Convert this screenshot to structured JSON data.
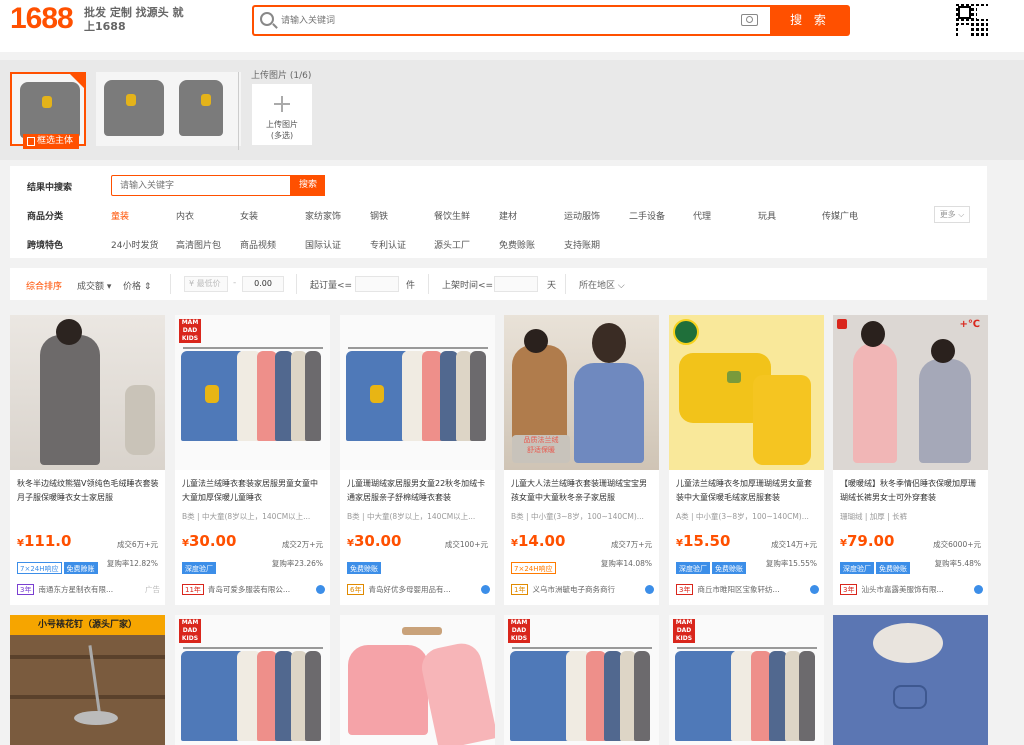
{
  "header": {
    "logo_number": "1688",
    "logo_tagline": "批发 定制 找源头 就上1688",
    "search_placeholder": "请输入关键词",
    "search_button": "搜 索"
  },
  "upload": {
    "main_subject_tag": "框选主体",
    "count_label": "上传图片 (1/6)",
    "upload_label": "上传图片\n(多选)"
  },
  "filters": {
    "result_search_label": "结果中搜索",
    "result_search_placeholder": "请输入关键字",
    "result_search_button": "搜索",
    "category_label": "商品分类",
    "categories": [
      "童装",
      "内衣",
      "女装",
      "家纺家饰",
      "钢铁",
      "餐饮生鲜",
      "建材",
      "运动服饰",
      "二手设备",
      "代理",
      "玩具",
      "传媒广电"
    ],
    "more_label": "更多",
    "feature_label": "跨境特色",
    "features": [
      "24小时发货",
      "高清图片包",
      "商品视频",
      "国际认证",
      "专利认证",
      "源头工厂",
      "免费赊账",
      "支持账期"
    ]
  },
  "sort": {
    "default_sort": "综合排序",
    "volume": "成交额",
    "price": "价格",
    "min_price_placeholder": "¥ 最低价",
    "max_price_value": "0.00",
    "moq_label": "起订量<=",
    "moq_unit": "件",
    "listing_time_label": "上架时间<=",
    "listing_time_unit": "天",
    "region_label": "所在地区"
  },
  "products": [
    {
      "title": "秋冬半边绒纹熊猫V领纯色毛绒睡衣套装月子服保暖睡衣女士家居服",
      "attrs": "",
      "price": "111.0",
      "sold": "成交6万+元",
      "badges": [
        "7×24H响应",
        "免费赊账"
      ],
      "repurchase": "复购率12.82%",
      "years": "3年",
      "shop": "南通东方星制衣有限...",
      "extra": "广告"
    },
    {
      "title": "儿童法兰绒睡衣套装家居服男童女童中大童加厚保暖儿童睡衣",
      "attrs": "B类 | 中大童(8岁以上，140CM以上...",
      "price": "30.00",
      "sold": "成交2万+元",
      "badges": [
        "深度验厂"
      ],
      "repurchase": "复购率23.26%",
      "years": "11年",
      "shop": "青岛可爱多服装有限公...",
      "extra": ""
    },
    {
      "title": "儿童珊瑚绒家居服男女童22秋冬加绒卡通家居服亲子舒棉绒睡衣套装",
      "attrs": "B类 | 中大童(8岁以上，140CM以上...",
      "price": "30.00",
      "sold": "成交100+元",
      "badges": [
        "免费赊账"
      ],
      "repurchase": "",
      "years": "6年",
      "shop": "青岛好优多母婴用品有...",
      "extra": ""
    },
    {
      "title": "儿童大人法兰绒睡衣套装珊瑚绒宝宝男孩女童中大童秋冬亲子家居服",
      "attrs": "B类 | 中小童(3~8岁，100~140CM)...",
      "price": "14.00",
      "sold": "成交7万+元",
      "badges": [
        "7×24H响应"
      ],
      "repurchase": "复购率14.08%",
      "years": "1年",
      "shop": "义乌市洲毓电子商务商行",
      "extra": ""
    },
    {
      "title": "儿童法兰绒睡衣冬加厚珊瑚绒男女童套装中大童保暖毛绒家居服套装",
      "attrs": "A类 | 中小童(3~8岁，100~140CM)...",
      "price": "15.50",
      "sold": "成交14万+元",
      "badges": [
        "深度验厂",
        "免费赊账"
      ],
      "repurchase": "复购率15.55%",
      "years": "3年",
      "shop": "商丘市睢阳区宝象轩纺...",
      "extra": ""
    },
    {
      "title": "【暖暖绒】秋冬季情侣睡衣保暖加厚珊瑚绒长裤男女士可外穿套装",
      "attrs": "珊瑚绒 | 加厚 | 长裤",
      "price": "79.00",
      "sold": "成交6000+元",
      "badges": [
        "深度验厂",
        "免费赊账"
      ],
      "repurchase": "复购率5.48%",
      "years": "3年",
      "shop": "汕头市嘉露美服饰有限...",
      "extra": ""
    }
  ],
  "row2_banner": "小号裱花钉（源头厂家）",
  "brand_text": "MAM DAD KIDS",
  "currency": "¥"
}
